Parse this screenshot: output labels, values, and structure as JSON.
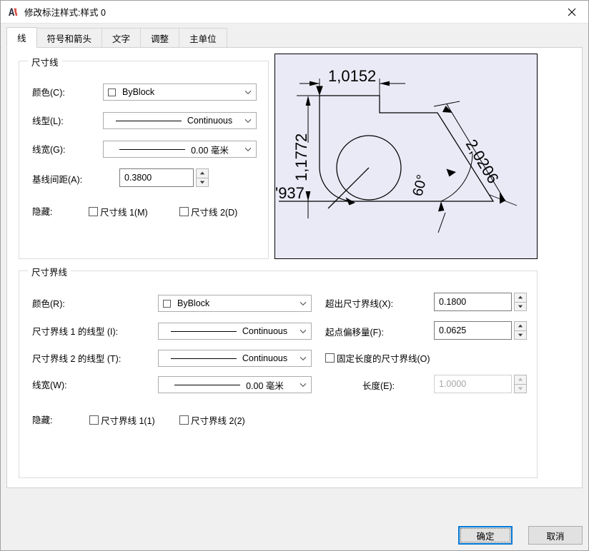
{
  "window": {
    "title": "修改标注样式:样式 0",
    "icon": "autocad-logo-icon",
    "close_label": "×"
  },
  "tabs": [
    {
      "label": "线",
      "selected": true
    },
    {
      "label": "符号和箭头",
      "selected": false
    },
    {
      "label": "文字",
      "selected": false
    },
    {
      "label": "调整",
      "selected": false
    },
    {
      "label": "主单位",
      "selected": false
    }
  ],
  "dimension_line_group": {
    "legend": "尺寸线",
    "color": {
      "label": "颜色(C):",
      "value": "ByBlock",
      "swatch": "#ffffff"
    },
    "linetype": {
      "label": "线型(L):",
      "value": "Continuous"
    },
    "lineweight": {
      "label": "线宽(G):",
      "value": "0.00 毫米"
    },
    "baseline_spacing": {
      "label": "基线间距(A):",
      "value": "0.3800"
    },
    "suppress": {
      "label": "隐藏:",
      "dimline1": {
        "label": "尺寸线 1(M)",
        "checked": false
      },
      "dimline2": {
        "label": "尺寸线 2(D)",
        "checked": false
      }
    }
  },
  "extension_line_group": {
    "legend": "尺寸界线",
    "color": {
      "label": "颜色(R):",
      "value": "ByBlock",
      "swatch": "#ffffff"
    },
    "linetype_ext1": {
      "label": "尺寸界线 1 的线型 (I):",
      "value": "Continuous"
    },
    "linetype_ext2": {
      "label": "尺寸界线 2 的线型 (T):",
      "value": "Continuous"
    },
    "lineweight": {
      "label": "线宽(W):",
      "value": "0.00 毫米"
    },
    "extend_beyond": {
      "label": "超出尺寸界线(X):",
      "value": "0.1800"
    },
    "offset_from_origin": {
      "label": "起点偏移量(F):",
      "value": "0.0625"
    },
    "fixed_length": {
      "label": "固定长度的尺寸界线(O)",
      "checked": false
    },
    "length": {
      "label": "长度(E):",
      "value": "1.0000",
      "disabled": true
    },
    "suppress": {
      "label": "隐藏:",
      "extline1": {
        "label": "尺寸界线 1(1)",
        "checked": false
      },
      "extline2": {
        "label": "尺寸界线 2(2)",
        "checked": false
      }
    }
  },
  "preview": {
    "background": "#eaeaf7",
    "stroke": "#000000",
    "dimensions": {
      "horizontal_top": "1,0152",
      "vertical_left": "1,1772",
      "radius_bottom_left": "937",
      "aligned_diagonal": "2,0206",
      "angular": "60°"
    }
  },
  "footer": {
    "ok_label": "确定",
    "cancel_label": "取消"
  },
  "colors": {
    "accent": "#0078d7",
    "dialog_bg": "#f0f0f0",
    "panel_bg": "#ffffff",
    "group_border": "#dcdcdc",
    "preview_bg": "#eaeaf7"
  }
}
